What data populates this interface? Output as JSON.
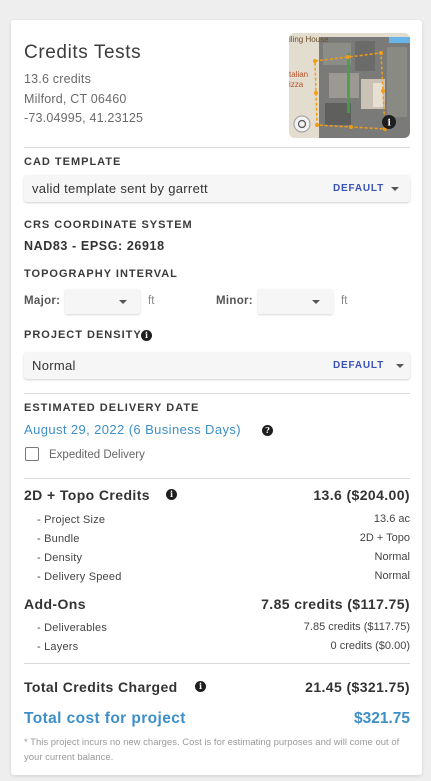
{
  "colors": {
    "accent_blue": "#3d8fc9",
    "default_badge": "#3a53b8",
    "card_bg": "#ffffff",
    "page_bg": "#eeeeee"
  },
  "header": {
    "title": "Credits Tests",
    "credits": "13.6 credits",
    "location": "Milford, CT 06460",
    "coordinates": "-73.04995, 41.23125",
    "map_labels": {
      "business": "iling House",
      "restaurant": "talian\nizza"
    },
    "map_icons": [
      "layers-icon",
      "info-icon"
    ]
  },
  "cad_template": {
    "section_label": "CAD TEMPLATE",
    "value": "valid template sent by garrett",
    "badge": "DEFAULT"
  },
  "crs": {
    "section_label": "CRS COORDINATE SYSTEM",
    "value": "NAD83 - EPSG: 26918"
  },
  "topography": {
    "section_label": "TOPOGRAPHY INTERVAL",
    "major_label": "Major:",
    "minor_label": "Minor:",
    "unit": "ft"
  },
  "density": {
    "section_label": "PROJECT DENSITY",
    "value": "Normal",
    "badge": "DEFAULT"
  },
  "delivery": {
    "section_label": "ESTIMATED DELIVERY DATE",
    "date_text": "August 29, 2022 (6 Business Days)",
    "expedited_label": "Expedited Delivery",
    "expedited_checked": false
  },
  "credits": {
    "heading": "2D + Topo Credits",
    "heading_value": "13.6 ($204.00)",
    "items": [
      {
        "label": "- Project Size",
        "value": "13.6 ac"
      },
      {
        "label": "- Bundle",
        "value": "2D + Topo"
      },
      {
        "label": "- Density",
        "value": "Normal"
      },
      {
        "label": "- Delivery Speed",
        "value": "Normal"
      }
    ]
  },
  "addons": {
    "heading": "Add-Ons",
    "heading_value": "7.85 credits ($117.75)",
    "items": [
      {
        "label": "- Deliverables",
        "value": "7.85 credits ($117.75)"
      },
      {
        "label": "- Layers",
        "value": "0 credits ($0.00)"
      }
    ]
  },
  "totals": {
    "charged_label": "Total Credits Charged",
    "charged_value": "21.45 ($321.75)",
    "cost_label": "Total cost for project",
    "cost_value": "$321.75",
    "footnote": "* This project incurs no new charges. Cost is for estimating purposes and will come out of your current balance."
  }
}
